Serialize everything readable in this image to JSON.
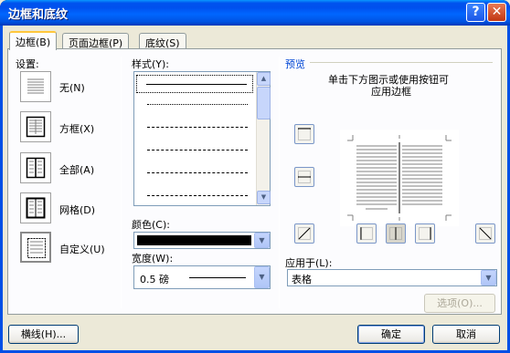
{
  "window": {
    "title": "边框和底纹"
  },
  "tabs": [
    {
      "label": "边框(B)"
    },
    {
      "label": "页面边框(P)"
    },
    {
      "label": "底纹(S)"
    }
  ],
  "settings": {
    "heading": "设置:",
    "items": [
      {
        "label": "无(N)"
      },
      {
        "label": "方框(X)"
      },
      {
        "label": "全部(A)"
      },
      {
        "label": "网格(D)"
      },
      {
        "label": "自定义(U)"
      }
    ]
  },
  "style": {
    "heading": "样式(Y):"
  },
  "color": {
    "heading": "颜色(C):",
    "value": "#000000"
  },
  "width": {
    "heading": "宽度(W):",
    "value": "0.5 磅"
  },
  "preview": {
    "heading": "预览",
    "hint_line1": "单击下方图示或使用按钮可",
    "hint_line2": "应用边框"
  },
  "apply_to": {
    "heading": "应用于(L):",
    "value": "表格"
  },
  "buttons": {
    "options": "选项(O)...",
    "horizontal_line": "横线(H)...",
    "ok": "确定",
    "cancel": "取消"
  },
  "titlebar_buttons": {
    "help": "?",
    "close": "✕"
  },
  "icons": {
    "help": "help-icon",
    "close": "close-icon",
    "dropdown": "chevron-down-icon"
  }
}
